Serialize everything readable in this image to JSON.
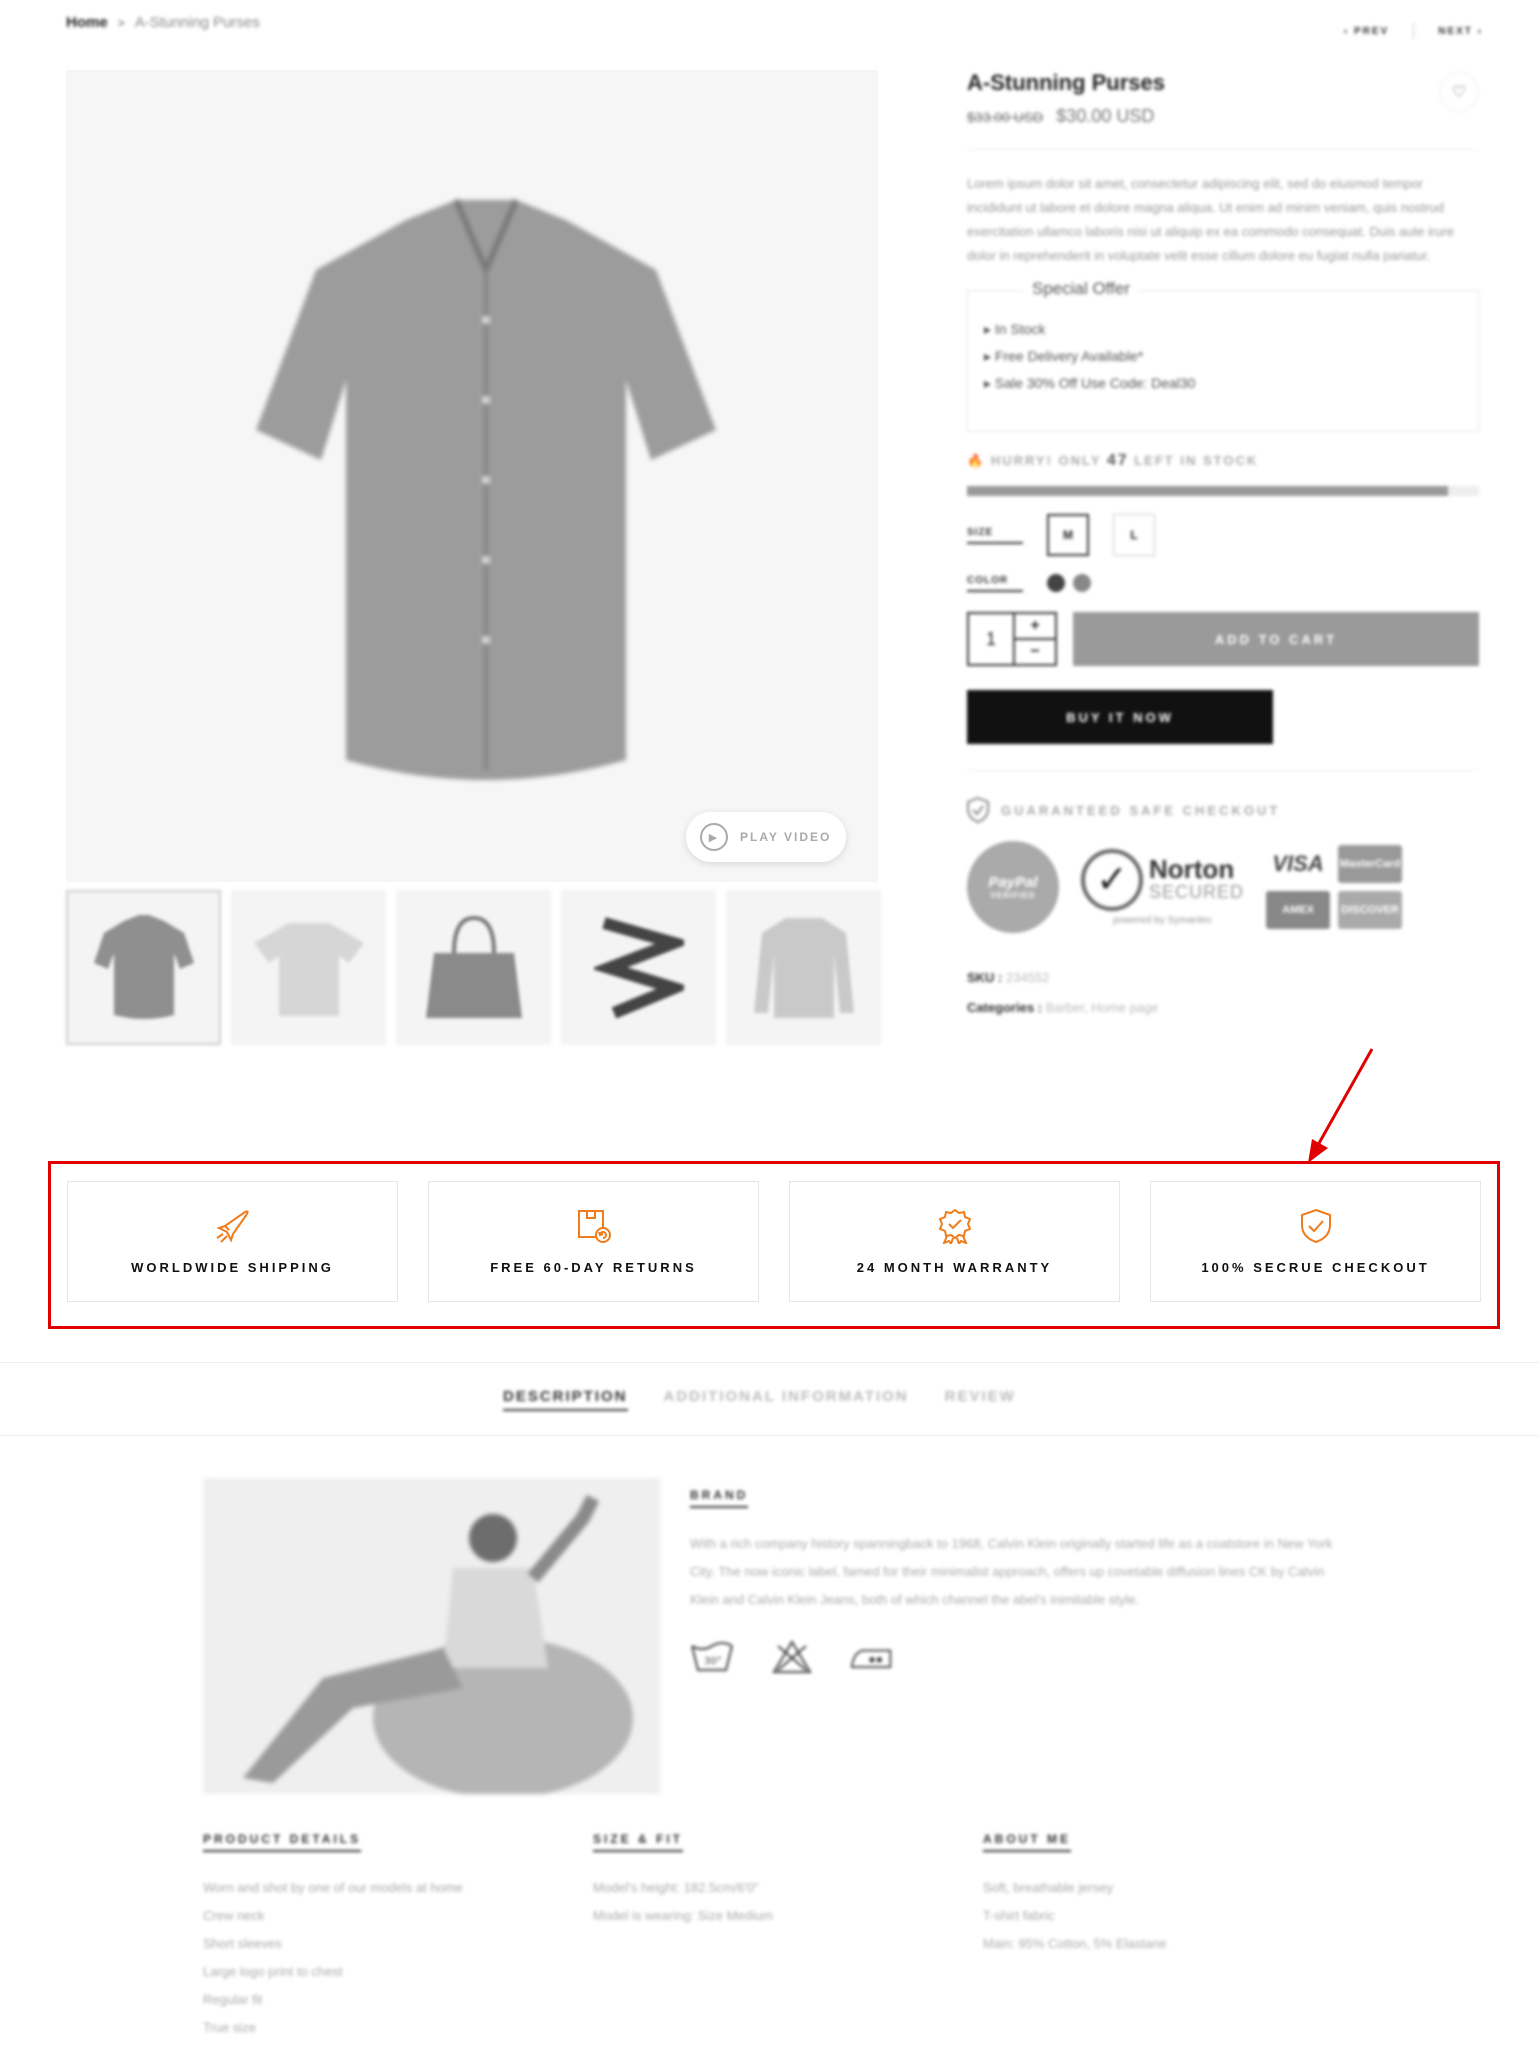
{
  "breadcrumb": {
    "home": "Home",
    "separator": ">",
    "current": "A-Stunning Purses"
  },
  "pager": {
    "prev": "PREV",
    "next": "NEXT"
  },
  "gallery": {
    "play_video": "PLAY VIDEO",
    "thumbnails": [
      "shirt",
      "t-shirt",
      "handbag",
      "belt",
      "sweater"
    ]
  },
  "product": {
    "title": "A-Stunning Purses",
    "old_price": "$33.00 USD",
    "price": "$30.00 USD",
    "description": "Lorem ipsum dolor sit amet, consectetur adipiscing elit, sed do eiusmod tempor incididunt ut labore et dolore magna aliqua. Ut enim ad minim veniam, quis nostrud exercitation ullamco laboris nisi ut aliquip ex ea commodo consequat. Duis aute irure dolor in reprehenderit in voluptate velit esse cillum dolore eu fugiat nulla pariatur.",
    "special_offer": {
      "legend": "Special Offer",
      "items": [
        "In Stock",
        "Free Delivery Available*",
        "Sale 30% Off Use Code: Deal30"
      ]
    },
    "stock": {
      "prefix": "HURRY! ONLY",
      "count": "47",
      "suffix": "LEFT IN STOCK",
      "fill_fraction": 0.94
    },
    "size": {
      "label": "SIZE",
      "options": [
        "M",
        "L"
      ],
      "selected": "M"
    },
    "color": {
      "label": "COLOR",
      "swatches": [
        "#444444",
        "#888888"
      ]
    },
    "quantity": "1",
    "add_to_cart": "ADD TO CART",
    "buy_now": "BUY IT NOW",
    "safe_checkout": "GUARANTEED SAFE CHECKOUT",
    "badges": {
      "paypal": "PayPal",
      "paypal_sub": "VERIFIED",
      "norton": "Norton",
      "norton_sub": "SECURED",
      "norton_powered": "powered by Symantec",
      "cards": [
        "VISA",
        "MasterCard",
        "AMEX",
        "DISCOVER"
      ]
    },
    "sku_label": "SKU :",
    "sku_value": "234552",
    "categories_label": "Categories :",
    "categories_value": "Barber, Home page"
  },
  "features": [
    {
      "label": "WORLDWIDE SHIPPING",
      "icon": "airplane-icon"
    },
    {
      "label": "FREE 60-DAY RETURNS",
      "icon": "return-box-icon"
    },
    {
      "label": "24 MONTH WARRANTY",
      "icon": "award-badge-icon"
    },
    {
      "label": "100% SECRUE CHECKOUT",
      "icon": "shield-check-icon"
    }
  ],
  "accent_color": "#f07c1b",
  "highlight_color": "#e00000",
  "tabs": [
    "DESCRIPTION",
    "ADDITIONAL INFORMATION",
    "REVIEW"
  ],
  "brand": {
    "heading": "BRAND",
    "text": "With a rich company history spanningback to 1968, Calvin Klein originally started life as a coatstore in New York City. The now iconic label, famed for their minimalist approach, offers up covetable diffusion lines CK by Calvin Klein and Calvin Klein Jeans, both of which channel the abel's inimitable style.",
    "care_icons": [
      "wash-30-icon",
      "no-bleach-icon",
      "iron-icon"
    ]
  },
  "details": {
    "product_details": {
      "heading": "PRODUCT DETAILS",
      "items": [
        "Worn and shot by one of our models at home",
        "Crew neck",
        "Short sleeves",
        "Large logo print to chest",
        "Regular fit",
        "True size"
      ]
    },
    "size_fit": {
      "heading": "SIZE & FIT",
      "items": [
        "Model's height: 182.5cm/6'0\"",
        "Model is wearing: Size Medium"
      ]
    },
    "about_me": {
      "heading": "ABOUT ME",
      "items": [
        "Soft, breathable jersey",
        "T-shirt fabric",
        "Main: 95% Cotton, 5% Elastane"
      ]
    }
  }
}
